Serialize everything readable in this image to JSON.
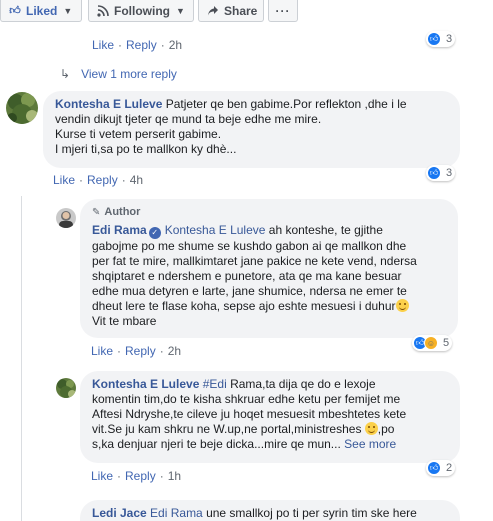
{
  "toolbar": {
    "liked_label": "Liked",
    "following_label": "Following",
    "share_label": "Share",
    "more_label": "···"
  },
  "comment0": {
    "like": "Like",
    "reply": "Reply",
    "time": "2h",
    "reactions": "3"
  },
  "view_more_label": "View 1 more reply",
  "comment1": {
    "author": "Kontesha E Luleve",
    "lines": [
      "Patjeter qe ben gabime.Por reflekton ,dhe i le",
      "vendin dikujt tjeter qe mund ta beje edhe me mire.",
      "Kurse ti vetem perserit gabime.",
      "I mjeri ti,sa po te mallkon ky dhè..."
    ],
    "like": "Like",
    "reply": "Reply",
    "time": "4h",
    "reactions": "3"
  },
  "comment2": {
    "author_tag": "Author",
    "author": "Edi Rama",
    "mention": "Kontesha E Luleve",
    "lines": [
      "ah konteshe, te gjithe",
      "gabojme po me shume se kushdo gabon ai qe mallkon dhe",
      "per fat te mire, mallkimtaret jane pakice ne kete vend, ndersa",
      "shqiptaret e ndershem e punetore, ata qe ma kane besuar",
      "edhe mua detyren e larte, jane shumice, ndersa ne emer te",
      "dheut lere te flase koha, sepse ajo eshte mesuesi i duhur",
      "Vit te mbare"
    ],
    "like": "Like",
    "reply": "Reply",
    "time": "2h",
    "reactions": "5"
  },
  "comment3": {
    "author": "Kontesha E Luleve",
    "mention": "#Edi",
    "lines": [
      "Rama,ta dija qe do e lexoje",
      "komentin tim,do te kisha shkruar edhe ketu per femijet me",
      "Aftesi Ndryshe,te cileve ju hoqet mesuesit mbeshtetes kete",
      "vit.Se ju kam shkru ne W.up,ne portal,ministreshes",
      ",po",
      "s,ka denjuar njeri te beje dicka...mire qe mun..."
    ],
    "see_more": "See more",
    "like": "Like",
    "reply": "Reply",
    "time": "1h",
    "reactions": "2"
  },
  "comment4": {
    "author": "Ledi Jace",
    "mention": "Edi Rama",
    "text": "une smallkoj po ti per syrin tim ske here"
  }
}
